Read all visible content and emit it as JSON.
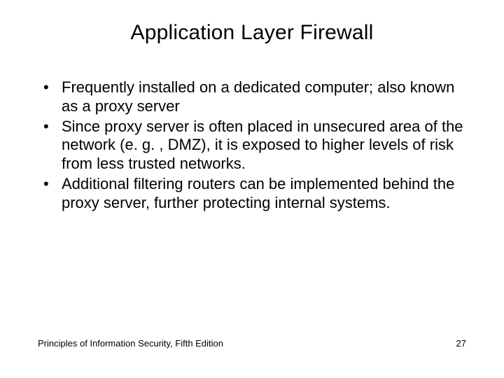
{
  "title": "Application Layer Firewall",
  "bullets": [
    "Frequently installed on a dedicated computer; also known as a proxy server",
    "Since proxy server is often placed in unsecured area of the network (e. g. , DMZ), it is exposed to higher levels of risk from less trusted networks.",
    "Additional filtering routers can be implemented behind the proxy server, further protecting internal systems."
  ],
  "footer": {
    "source": "Principles of Information Security, Fifth Edition",
    "page": "27"
  }
}
